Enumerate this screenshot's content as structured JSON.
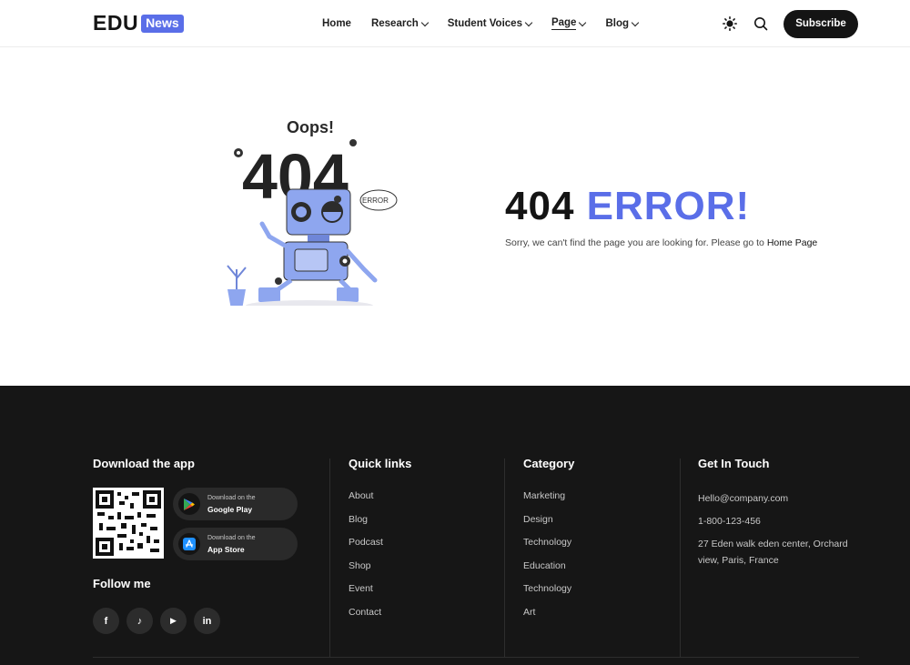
{
  "brand": {
    "logo_text": "EDU",
    "logo_badge": "News"
  },
  "nav": {
    "items": [
      {
        "label": "Home",
        "dropdown": false,
        "active": false
      },
      {
        "label": "Research",
        "dropdown": true,
        "active": false
      },
      {
        "label": "Student Voices",
        "dropdown": true,
        "active": false
      },
      {
        "label": "Page",
        "dropdown": true,
        "active": true
      },
      {
        "label": "Blog",
        "dropdown": true,
        "active": false
      }
    ],
    "subscribe_label": "Subscribe",
    "icons": [
      "sun-icon",
      "search-icon"
    ]
  },
  "error": {
    "illustration_oops": "Oops!",
    "illustration_code": "404",
    "illustration_tag": "ERROR",
    "code": "404",
    "title": "ERROR!",
    "message": "Sorry, we can't find the page you are looking for. Please go to",
    "home_link": "Home Page"
  },
  "footer": {
    "download_title": "Download the app",
    "google_play": {
      "small": "Download on the",
      "big": "Google Play"
    },
    "app_store": {
      "small": "Download on the",
      "big": "App Store"
    },
    "follow_title": "Follow me",
    "socials": [
      {
        "name": "facebook",
        "glyph": "f"
      },
      {
        "name": "tiktok",
        "glyph": "♪"
      },
      {
        "name": "youtube",
        "glyph": "▶"
      },
      {
        "name": "linkedin",
        "glyph": "in"
      }
    ],
    "quick_links_title": "Quick links",
    "quick_links": [
      "About",
      "Blog",
      "Podcast",
      "Shop",
      "Event",
      "Contact"
    ],
    "category_title": "Category",
    "categories": [
      "Marketing",
      "Design",
      "Technology",
      "Education",
      "Technology",
      "Art"
    ],
    "contact_title": "Get In Touch",
    "email": "Hello@company.com",
    "phone": "1-800-123-456",
    "address": "27 Eden walk eden center, Orchard view, Paris, France"
  },
  "colors": {
    "accent": "#5a6ee8",
    "dark": "#141414",
    "footer_bg": "#161616"
  }
}
